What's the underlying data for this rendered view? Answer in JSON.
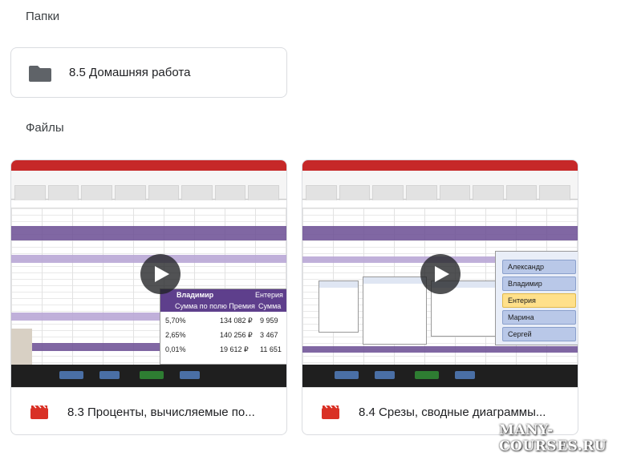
{
  "sections": {
    "folders_title": "Папки",
    "files_title": "Файлы"
  },
  "folders": [
    {
      "name": "8.5 Домашняя работа",
      "icon": "folder-icon"
    }
  ],
  "files": [
    {
      "name": "8.3 Проценты, вычисляемые по...",
      "icon": "video-file-icon",
      "thumbnail": {
        "pivot_header": "Владимир",
        "pivot_col": "Сумма по полю Премия",
        "pivot_col2": "Сумма",
        "pivot_col3": "Ентерия",
        "rows": [
          {
            "pct": "5,70%",
            "value": "134 082 ₽",
            "extra": "9 959"
          },
          {
            "pct": "2,65%",
            "value": "140 256 ₽",
            "extra": "3 467"
          },
          {
            "pct": "0,01%",
            "value": "19 612 ₽",
            "extra": "11 651"
          }
        ]
      }
    },
    {
      "name": "8.4 Срезы, сводные диаграммы...",
      "icon": "video-file-icon",
      "thumbnail": {
        "slicer_items": [
          "Александр",
          "Владимир",
          "Ентерия",
          "Марина",
          "Сергей"
        ],
        "selected_index": 2
      }
    }
  ],
  "watermark": "MANY-COURSES.RU",
  "colors": {
    "accent_red": "#c62828",
    "pivot_purple": "#5e3f8c",
    "folder_gray": "#5f6368"
  }
}
